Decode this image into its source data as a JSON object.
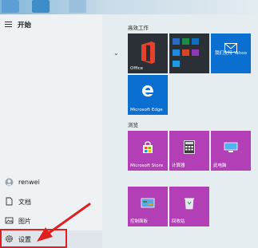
{
  "start_menu": {
    "title": "开始"
  },
  "nav": {
    "user": "renwei",
    "documents": "文档",
    "pictures": "图片",
    "settings": "设置"
  },
  "groups": {
    "productivity": "高效工作",
    "browse": "浏览"
  },
  "tiles": {
    "office": "Office",
    "yahoo": "我们支持 Yahoo",
    "edge": "Microsoft Edge",
    "store": "Microsoft Store",
    "calculator": "计算器",
    "this_pc": "此电脑",
    "control_panel": "控制面板",
    "recycle_bin": "回收站"
  },
  "colors": {
    "tile_blue": "#0a6fd1",
    "tile_purple": "#b23fb6",
    "tile_dark": "#2b2f36",
    "highlight": "#e02020"
  }
}
